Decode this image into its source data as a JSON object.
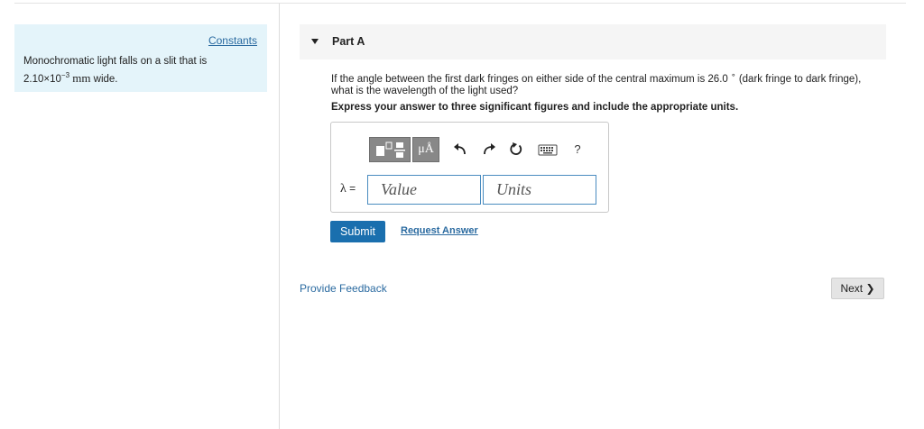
{
  "problem": {
    "constants_label": "Constants",
    "text_line1": "Monochromatic light falls on a slit that is",
    "width_mantissa": "2.10×10",
    "width_exponent": "−3",
    "width_unit": "mm",
    "text_suffix": " wide."
  },
  "part": {
    "title": "Part A",
    "question_before": "If the angle between the first dark fringes on either side of the central maximum is 26.0",
    "question_degree": "∘",
    "question_after": " (dark fringe to dark fringe), what is the wavelength of the light used?",
    "instruction": "Express your answer to three significant figures and include the appropriate units."
  },
  "answer": {
    "variable": "λ",
    "equals": " =",
    "value_placeholder": "Value",
    "value": "",
    "units_placeholder": "Units",
    "units": ""
  },
  "toolbar": {
    "units_button": "μÅ",
    "help": "?",
    "icons": [
      "template-icon",
      "units-icon",
      "undo-icon",
      "redo-icon",
      "reset-icon",
      "keyboard-icon",
      "help-icon"
    ]
  },
  "actions": {
    "submit": "Submit",
    "request_answer": "Request Answer",
    "provide_feedback": "Provide Feedback",
    "next": "Next",
    "next_chevron": "❯"
  },
  "colors": {
    "panel_bg": "#e4f4fa",
    "submit_bg": "#1a6fae",
    "link": "#2a6aa0",
    "input_border": "#4a8cc0"
  }
}
